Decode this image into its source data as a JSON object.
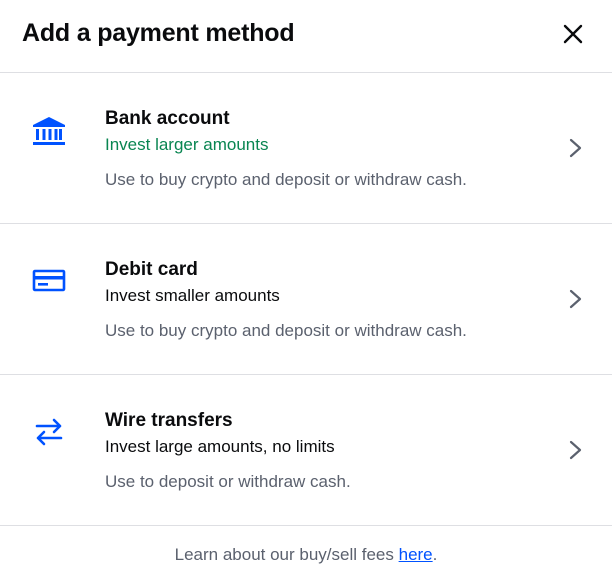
{
  "header": {
    "title": "Add a payment method",
    "close_icon": "close-icon"
  },
  "colors": {
    "accent_blue": "#0052ff",
    "positive_green": "#098551",
    "muted_text": "#5b616e",
    "divider": "#dedfe3"
  },
  "options": [
    {
      "icon": "bank-icon",
      "title": "Bank account",
      "subtitle": "Invest larger amounts",
      "description": "Use to buy crypto and deposit or withdraw cash."
    },
    {
      "icon": "debit-card-icon",
      "title": "Debit card",
      "subtitle": "Invest smaller amounts",
      "description": "Use to buy crypto and deposit or withdraw cash."
    },
    {
      "icon": "transfer-arrows-icon",
      "title": "Wire transfers",
      "subtitle": "Invest large amounts, no limits",
      "description": "Use to deposit or withdraw cash."
    }
  ],
  "footer": {
    "text": "Learn about our buy/sell fees ",
    "link": "here",
    "suffix": "."
  }
}
